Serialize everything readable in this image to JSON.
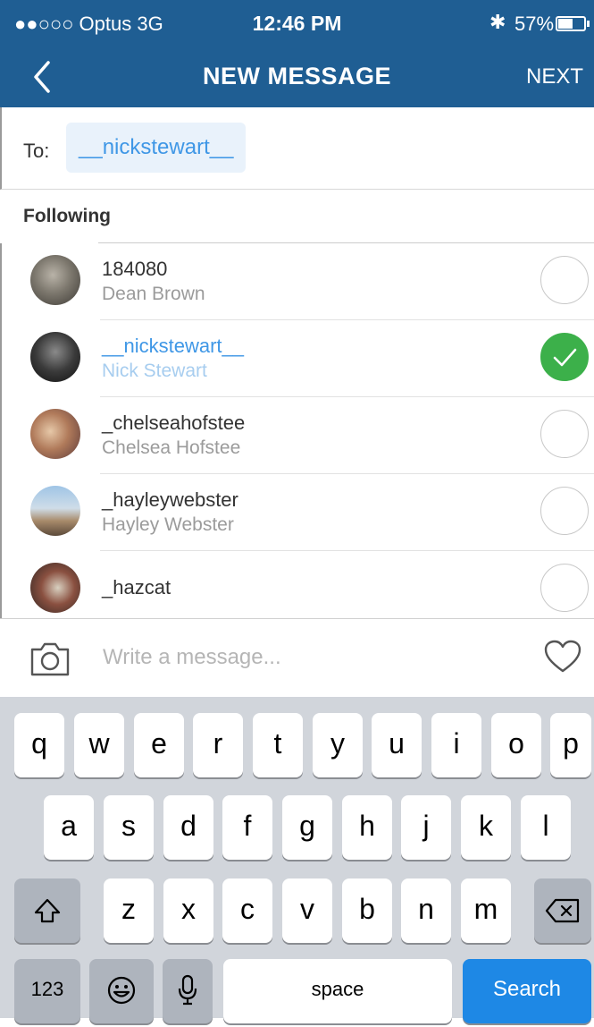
{
  "status": {
    "carrier": "●●○○○ Optus  3G",
    "time": "12:46 PM",
    "battery": "57%",
    "battery_level": 0.57
  },
  "nav": {
    "title": "NEW MESSAGE",
    "next": "NEXT"
  },
  "to": {
    "label": "To:",
    "recipient": "__nickstewart__"
  },
  "following_label": "Following",
  "contacts": [
    {
      "username": "184080",
      "name": "Dean Brown",
      "selected": false
    },
    {
      "username": "__nickstewart__",
      "name": "Nick Stewart",
      "selected": true
    },
    {
      "username": "_chelseahofstee",
      "name": "Chelsea Hofstee",
      "selected": false
    },
    {
      "username": "_hayleywebster",
      "name": "Hayley Webster",
      "selected": false
    },
    {
      "username": "_hazcat",
      "name": "",
      "selected": false
    }
  ],
  "compose": {
    "placeholder": "Write a message..."
  },
  "keyboard": {
    "row1": [
      "q",
      "w",
      "e",
      "r",
      "t",
      "y",
      "u",
      "i",
      "o",
      "p"
    ],
    "row2": [
      "a",
      "s",
      "d",
      "f",
      "g",
      "h",
      "j",
      "k",
      "l"
    ],
    "row3": [
      "z",
      "x",
      "c",
      "v",
      "b",
      "n",
      "m"
    ],
    "numbers": "123",
    "space": "space",
    "search": "Search"
  },
  "colors": {
    "nav_bg": "#1f5e93",
    "accent": "#3f97e6",
    "check": "#3cb04a",
    "search_key": "#1e88e5"
  }
}
